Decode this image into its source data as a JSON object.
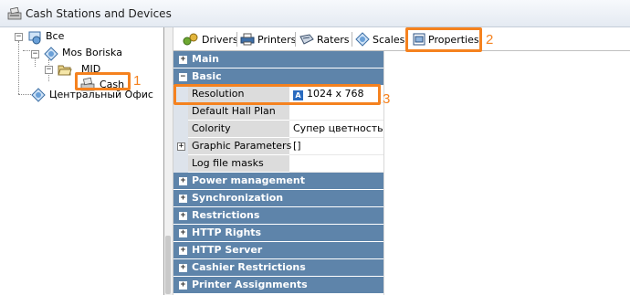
{
  "window": {
    "title": "Cash Stations and Devices"
  },
  "tree": {
    "root": {
      "label": "Все"
    },
    "shop": {
      "label": "Mos Boriska"
    },
    "group": {
      "label": "MID"
    },
    "cash": {
      "label": "Cash"
    },
    "office": {
      "label": "Центральный Офис"
    }
  },
  "tabs": [
    {
      "label": "Drivers",
      "icon": "drivers-icon"
    },
    {
      "label": "Printers",
      "icon": "printer-icon"
    },
    {
      "label": "Raters",
      "icon": "raters-icon"
    },
    {
      "label": "Scales",
      "icon": "scales-icon"
    },
    {
      "label": "Properties",
      "icon": "properties-icon"
    }
  ],
  "grid": {
    "categories": {
      "main": "Main",
      "basic": "Basic",
      "power": "Power management",
      "sync": "Synchronization",
      "restrictions": "Restrictions",
      "http_rights": "HTTP Rights",
      "http_server": "HTTP Server",
      "cashier": "Cashier Restrictions",
      "printer_assign": "Printer Assignments"
    },
    "properties": {
      "resolution": {
        "name": "Resolution",
        "value": "1024 x 768"
      },
      "hall_plan": {
        "name": "Default Hall Plan",
        "value": ""
      },
      "colority": {
        "name": "Colority",
        "value": "Супер цветность"
      },
      "graphic": {
        "name": "Graphic Parameters",
        "value": "[]"
      },
      "log_masks": {
        "name": "Log file masks",
        "value": ""
      }
    }
  },
  "annotations": {
    "one": "1",
    "two": "2",
    "three": "3"
  },
  "colors": {
    "accent_highlight": "#f5821f",
    "category_header": "#5e84aa"
  }
}
